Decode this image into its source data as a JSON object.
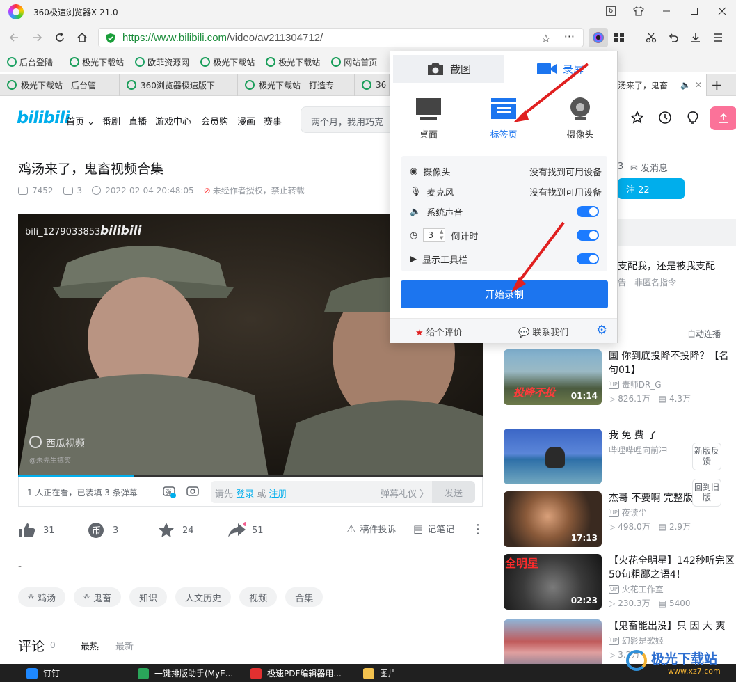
{
  "window": {
    "title": "360极速浏览器X 21.0",
    "tab_count_badge": "6"
  },
  "address": {
    "url_host": "https://www.bilibili.com",
    "url_path": "/video/av211304712/"
  },
  "bookmarks": [
    "后台登陆 -",
    "极光下载站",
    "欧菲资源网",
    "极光下载站",
    "极光下载站",
    "网站首页"
  ],
  "tabs": [
    {
      "label": "极光下载站 - 后台管"
    },
    {
      "label": "360浏览器极速版下"
    },
    {
      "label": "极光下载站 - 打造专"
    },
    {
      "label": "36"
    },
    {
      "label": "汤来了，鬼畜"
    }
  ],
  "bili_nav": {
    "logo": "bilibili",
    "items": [
      "首页",
      "番剧",
      "直播",
      "游戏中心",
      "会员购",
      "漫画",
      "赛事"
    ],
    "search_placeholder": "两个月，我用巧克"
  },
  "video": {
    "title": "鸡汤来了，鬼畜视频合集",
    "views": "7452",
    "danmaku": "3",
    "date": "2022-02-04 20:48:05",
    "copyright": "未经作者授权，禁止转载",
    "watermark_user": "bili_1279033853",
    "watermark_logo": "bilibili",
    "xigua": "西瓜视频",
    "xigua_sub": "@朱先生搞笑",
    "viewing": "1 人正在看，已装填 3 条弹幕",
    "danmaku_input_prefix": "请先",
    "danmaku_login": "登录",
    "danmaku_or": "或",
    "danmaku_register": "注册",
    "danmaku_etiquette": "弹幕礼仪 〉",
    "send": "发送",
    "likes": "31",
    "coins": "3",
    "favorites": "24",
    "shares": "51",
    "report": "稿件投诉",
    "notes": "记笔记",
    "desc": "-",
    "tags": [
      "鸡汤",
      "鬼畜",
      "知识",
      "人文历史",
      "视频",
      "合集"
    ],
    "comments_label": "评论",
    "comments_count": "0",
    "sort_hot": "最热",
    "sort_new": "最新"
  },
  "right": {
    "msg_count": "3",
    "send_msg": "发消息",
    "follow": "注 22",
    "list_title": "支配我，还是被我支配",
    "list_sub": "非匿名指令",
    "list_sub_prefix": "告",
    "autoplay": "自动连播",
    "recs": [
      {
        "title": "国 你到底投降不投降？【名句01】",
        "up": "毒师DR_G",
        "plays": "826.1万",
        "danmaku": "4.3万",
        "dur": "01:14"
      },
      {
        "title": "我 免 费 了",
        "up": "哔哩哔哩向前冲",
        "plays": "",
        "danmaku": "",
        "dur": ""
      },
      {
        "title": "杰哥 不要啊 完整版",
        "up": "夜读尘",
        "plays": "498.0万",
        "danmaku": "2.9万",
        "dur": "17:13"
      },
      {
        "title": "【火花全明星】142秒听完区50句粗鄙之语4！",
        "up": "火花工作室",
        "plays": "230.3万",
        "danmaku": "5400",
        "dur": "02:23"
      },
      {
        "title": "【鬼畜能出没】只 因 大 爽",
        "up": "幻影是歌姬",
        "plays": "3.2万",
        "danmaku": "",
        "dur": ""
      }
    ],
    "float_new": "新版反馈",
    "float_old": "回到旧版"
  },
  "popup": {
    "tab_screenshot": "截图",
    "tab_record": "录屏",
    "sources": [
      "桌面",
      "标签页",
      "摄像头"
    ],
    "camera_label": "摄像头",
    "camera_value": "没有找到可用设备",
    "mic_label": "麦克风",
    "mic_value": "没有找到可用设备",
    "system_audio": "系统声音",
    "countdown_value": "3",
    "countdown_label": "倒计时",
    "toolbar_label": "显示工具栏",
    "start": "开始录制",
    "rate": "给个评价",
    "contact": "联系我们"
  },
  "taskbar": [
    "钉钉",
    "一键排版助手(MyE...",
    "极速PDF编辑器用...",
    "图片"
  ],
  "watermark": {
    "brand": "极光下载站",
    "site": "www.xz7.com"
  },
  "colors": {
    "accent": "#1c75ef",
    "bili_pink": "#fb7299",
    "bili_blue": "#00aeec",
    "arrow": "#e02020"
  }
}
